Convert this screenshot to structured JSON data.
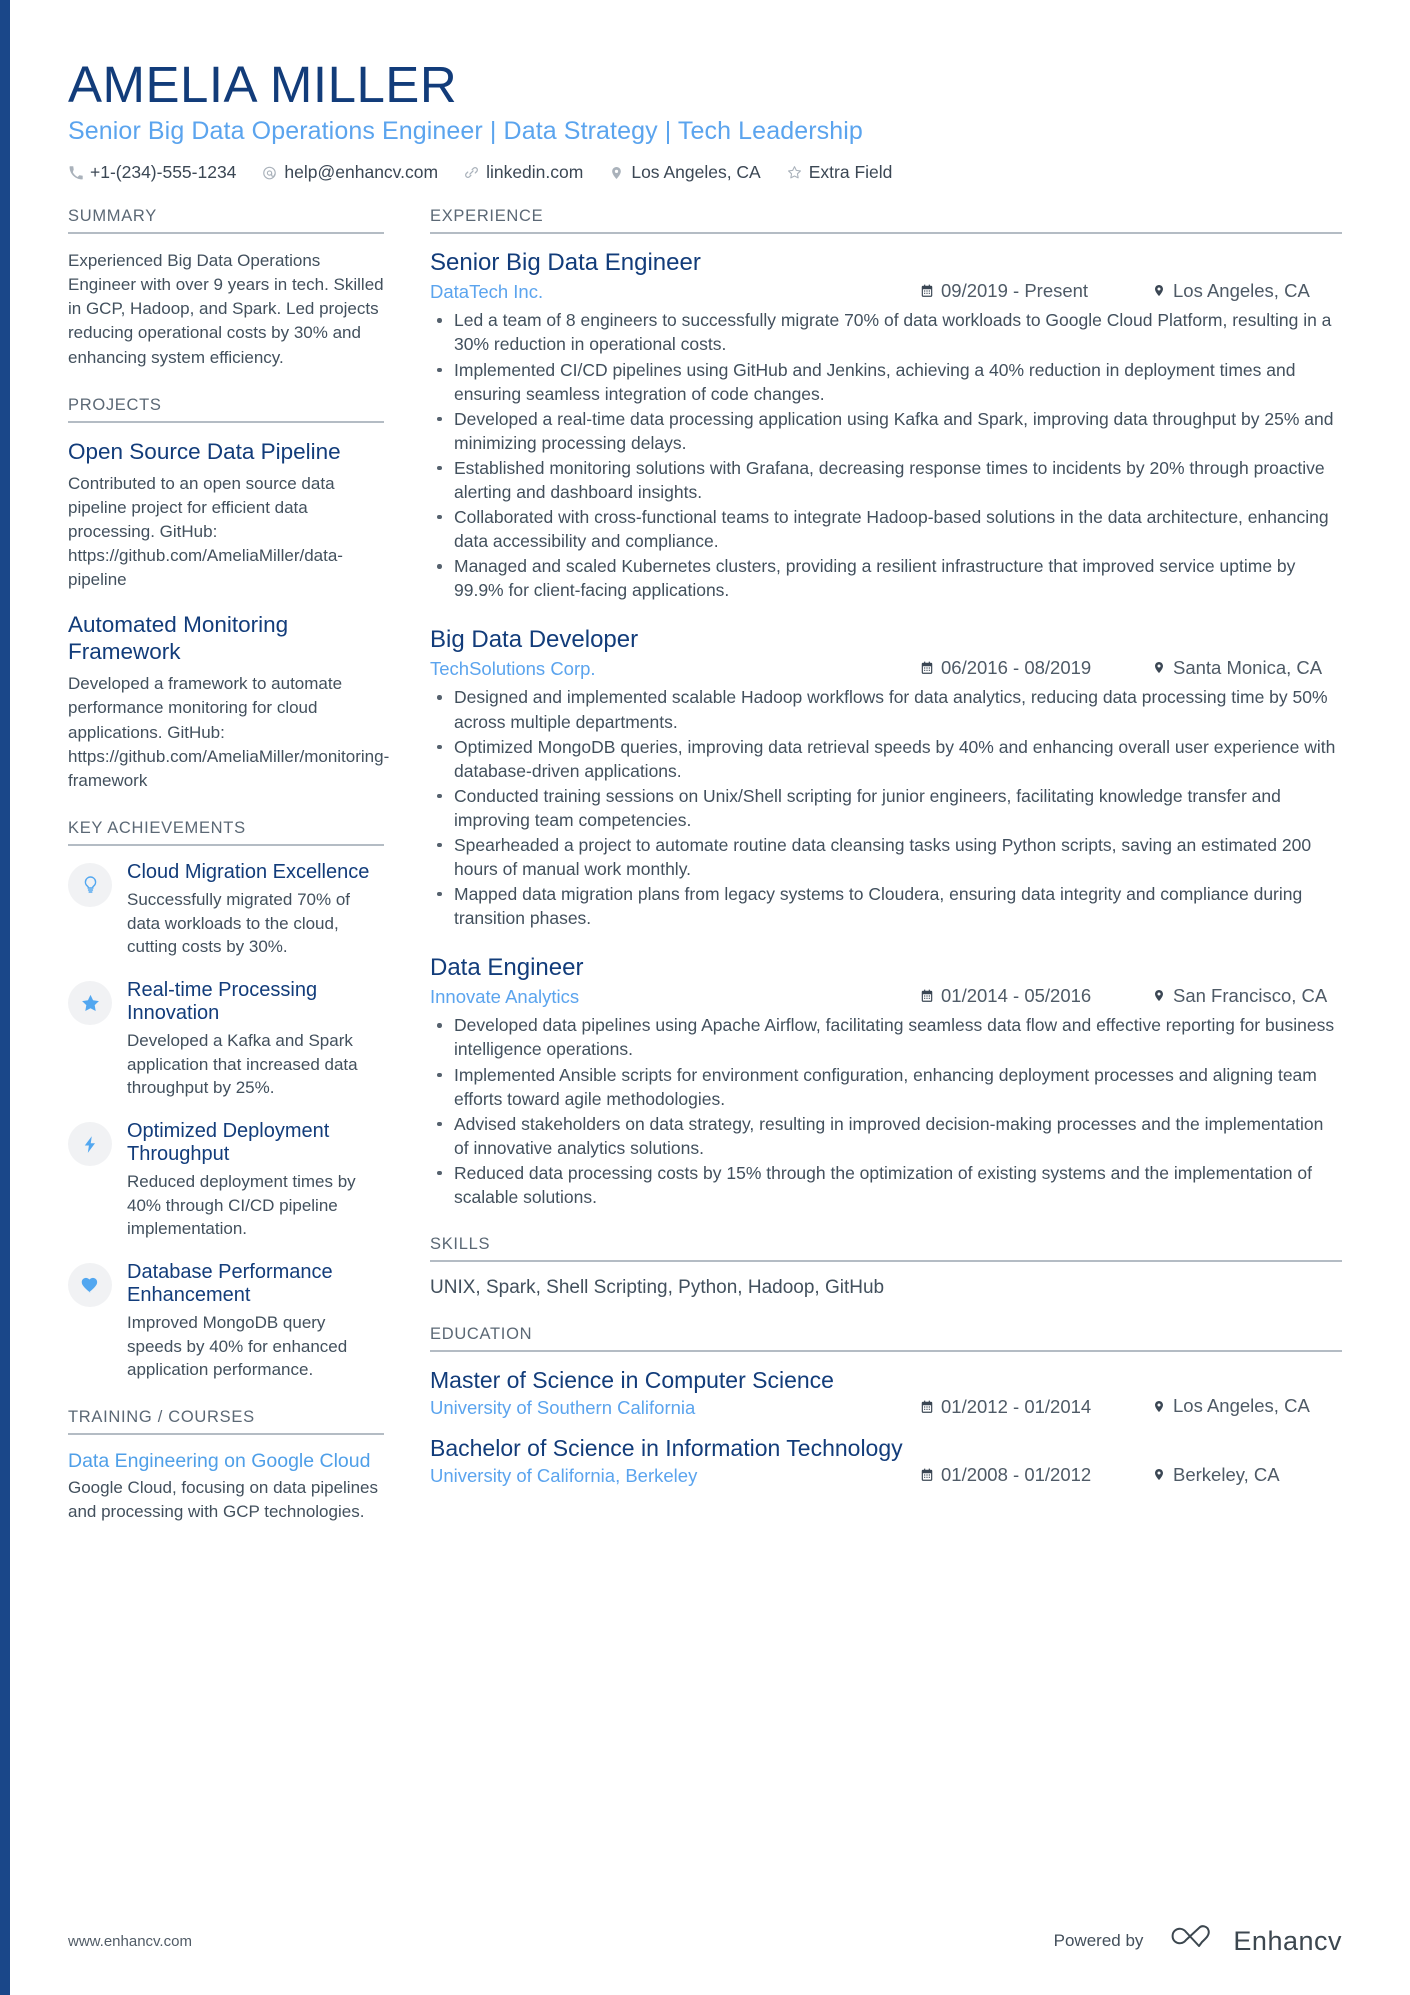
{
  "header": {
    "name": "AMELIA MILLER",
    "headline": "Senior Big Data Operations Engineer | Data Strategy | Tech Leadership",
    "contacts": [
      {
        "icon": "phone-icon",
        "text": "+1-(234)-555-1234"
      },
      {
        "icon": "email-icon",
        "text": "help@enhancv.com"
      },
      {
        "icon": "link-icon",
        "text": "linkedin.com"
      },
      {
        "icon": "location-pin-icon",
        "text": "Los Angeles, CA"
      },
      {
        "icon": "star-icon",
        "text": "Extra Field"
      }
    ]
  },
  "sidebar": {
    "summary": {
      "title": "SUMMARY",
      "text": "Experienced Big Data Operations Engineer with over 9 years in tech. Skilled in GCP, Hadoop, and Spark. Led projects reducing operational costs by 30% and enhancing system efficiency."
    },
    "projects": {
      "title": "PROJECTS",
      "items": [
        {
          "name": "Open Source Data Pipeline",
          "description": "Contributed to an open source data pipeline project for efficient data processing. GitHub: https://github.com/AmeliaMiller/data-pipeline"
        },
        {
          "name": "Automated Monitoring Framework",
          "description": "Developed a framework to automate performance monitoring for cloud applications. GitHub: https://github.com/AmeliaMiller/monitoring-framework"
        }
      ]
    },
    "achievements": {
      "title": "KEY ACHIEVEMENTS",
      "items": [
        {
          "icon": "lightbulb-icon",
          "title": "Cloud Migration Excellence",
          "description": "Successfully migrated 70% of data workloads to the cloud, cutting costs by 30%."
        },
        {
          "icon": "star-icon",
          "title": "Real-time Processing Innovation",
          "description": "Developed a Kafka and Spark application that increased data throughput by 25%."
        },
        {
          "icon": "lightning-bolt-icon",
          "title": "Optimized Deployment Throughput",
          "description": "Reduced deployment times by 40% through CI/CD pipeline implementation."
        },
        {
          "icon": "heart-icon",
          "title": "Database Performance Enhancement",
          "description": "Improved MongoDB query speeds by 40% for enhanced application performance."
        }
      ]
    },
    "training": {
      "title": "TRAINING / COURSES",
      "items": [
        {
          "name": "Data Engineering on Google Cloud",
          "description": "Google Cloud, focusing on data pipelines and processing with GCP technologies."
        }
      ]
    }
  },
  "main": {
    "experience": {
      "title": "EXPERIENCE",
      "jobs": [
        {
          "role": "Senior Big Data Engineer",
          "company": "DataTech Inc.",
          "dates": "09/2019 - Present",
          "location": "Los Angeles, CA",
          "bullets": [
            "Led a team of 8 engineers to successfully migrate 70% of data workloads to Google Cloud Platform, resulting in a 30% reduction in operational costs.",
            "Implemented CI/CD pipelines using GitHub and Jenkins, achieving a 40% reduction in deployment times and ensuring seamless integration of code changes.",
            "Developed a real-time data processing application using Kafka and Spark, improving data throughput by 25% and minimizing processing delays.",
            "Established monitoring solutions with Grafana, decreasing response times to incidents by 20% through proactive alerting and dashboard insights.",
            "Collaborated with cross-functional teams to integrate Hadoop-based solutions in the data architecture, enhancing data accessibility and compliance.",
            "Managed and scaled Kubernetes clusters, providing a resilient infrastructure that improved service uptime by 99.9% for client-facing applications."
          ]
        },
        {
          "role": "Big Data Developer",
          "company": "TechSolutions Corp.",
          "dates": "06/2016 - 08/2019",
          "location": "Santa Monica, CA",
          "bullets": [
            "Designed and implemented scalable Hadoop workflows for data analytics, reducing data processing time by 50% across multiple departments.",
            "Optimized MongoDB queries, improving data retrieval speeds by 40% and enhancing overall user experience with database-driven applications.",
            "Conducted training sessions on Unix/Shell scripting for junior engineers, facilitating knowledge transfer and improving team competencies.",
            "Spearheaded a project to automate routine data cleansing tasks using Python scripts, saving an estimated 200 hours of manual work monthly.",
            "Mapped data migration plans from legacy systems to Cloudera, ensuring data integrity and compliance during transition phases."
          ]
        },
        {
          "role": "Data Engineer",
          "company": "Innovate Analytics",
          "dates": "01/2014 - 05/2016",
          "location": "San Francisco, CA",
          "bullets": [
            "Developed data pipelines using Apache Airflow, facilitating seamless data flow and effective reporting for business intelligence operations.",
            "Implemented Ansible scripts for environment configuration, enhancing deployment processes and aligning team efforts toward agile methodologies.",
            "Advised stakeholders on data strategy, resulting in improved decision-making processes and the implementation of innovative analytics solutions.",
            "Reduced data processing costs by 15% through the optimization of existing systems and the implementation of scalable solutions."
          ]
        }
      ]
    },
    "skills": {
      "title": "SKILLS",
      "list": "UNIX, Spark, Shell Scripting, Python, Hadoop, GitHub"
    },
    "education": {
      "title": "EDUCATION",
      "items": [
        {
          "degree": "Master of Science in Computer Science",
          "school": "University of Southern California",
          "dates": "01/2012 - 01/2014",
          "location": "Los Angeles, CA"
        },
        {
          "degree": "Bachelor of Science in Information Technology",
          "school": "University of California, Berkeley",
          "dates": "01/2008 - 01/2012",
          "location": "Berkeley, CA"
        }
      ]
    }
  },
  "footer": {
    "website": "www.enhancv.com",
    "powered_by": "Powered by",
    "brand": "Enhancv"
  },
  "colors": {
    "accent_dark_blue": "#123c7a",
    "accent_light_blue": "#5ba4ee",
    "icon_blue": "#52a7f0",
    "body_gray": "#42505d",
    "rule_gray": "#b4bcc4"
  }
}
